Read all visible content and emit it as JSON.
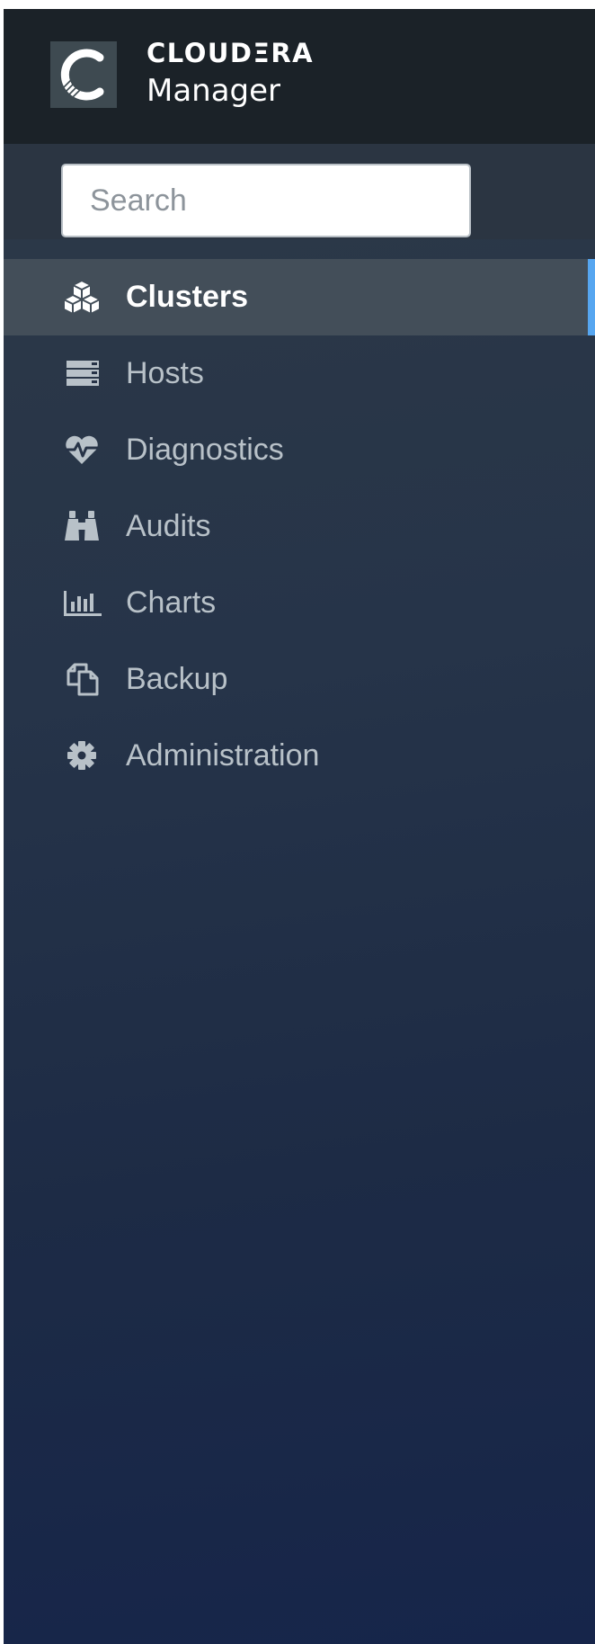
{
  "brand": {
    "name": "CLOUDΞRA",
    "product": "Manager",
    "logo_icon": "cloudera-c-icon"
  },
  "search": {
    "placeholder": "Search",
    "value": ""
  },
  "nav": {
    "items": [
      {
        "label": "Clusters",
        "icon": "cubes-icon",
        "active": true
      },
      {
        "label": "Hosts",
        "icon": "server-icon",
        "active": false
      },
      {
        "label": "Diagnostics",
        "icon": "heartbeat-icon",
        "active": false
      },
      {
        "label": "Audits",
        "icon": "binoculars-icon",
        "active": false
      },
      {
        "label": "Charts",
        "icon": "bar-chart-icon",
        "active": false
      },
      {
        "label": "Backup",
        "icon": "copy-icon",
        "active": false
      },
      {
        "label": "Administration",
        "icon": "gear-icon",
        "active": false
      }
    ]
  },
  "colors": {
    "header_bg": "#1b2228",
    "sidebar_top": "#2e3a47",
    "sidebar_bottom": "#16254a",
    "active_item_bg": "#434e59",
    "active_indicator": "#56a6f0",
    "nav_text": "#b8c1c8",
    "nav_text_active": "#ffffff"
  }
}
